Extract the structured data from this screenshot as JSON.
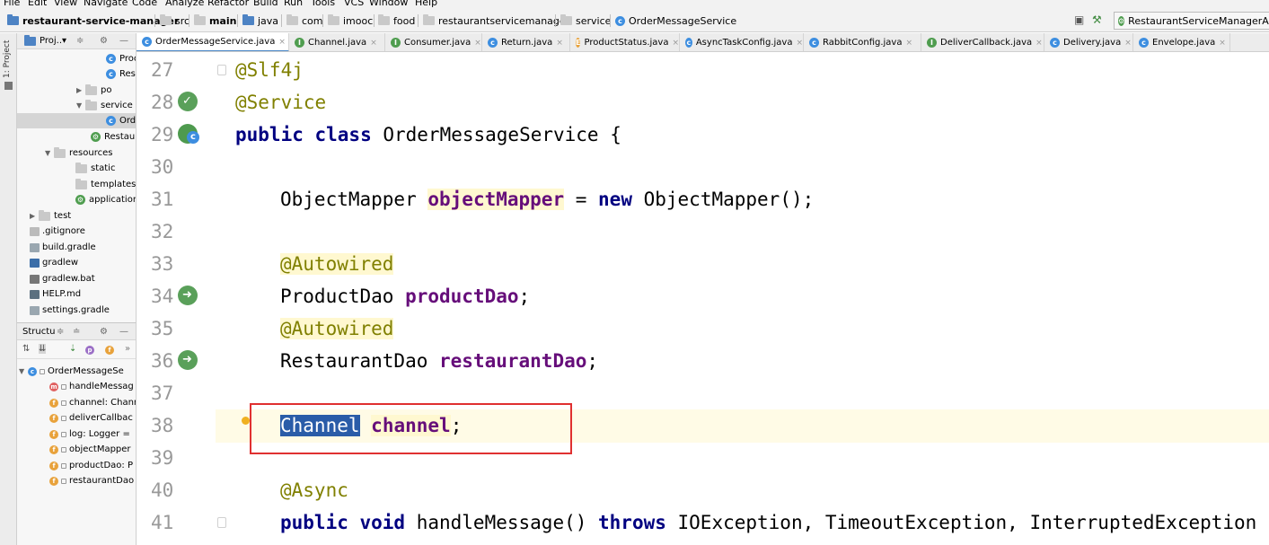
{
  "menu": [
    "File",
    "Edit",
    "View",
    "Navigate",
    "Code",
    "Analyze",
    "Refactor",
    "Build",
    "Run",
    "Tools",
    "VCS",
    "Window",
    "Help"
  ],
  "breadcrumb": [
    "restaurant-service-manager",
    "src",
    "main",
    "java",
    "com",
    "imooc",
    "food",
    "restaurantservicemanager",
    "service",
    "OrderMessageService"
  ],
  "run_config": "RestaurantServiceManagerAppl",
  "sidebar_tab": "1: Project",
  "project_panel": {
    "title": "Proj..▾",
    "tree": [
      {
        "label": "Proc",
        "kind": "class"
      },
      {
        "label": "Rest",
        "kind": "class"
      },
      {
        "label": "po",
        "kind": "package"
      },
      {
        "label": "service",
        "kind": "package"
      },
      {
        "label": "Ord",
        "kind": "class"
      },
      {
        "label": "Restaur",
        "kind": "spring"
      },
      {
        "label": "resources",
        "kind": "folder"
      },
      {
        "label": "static",
        "kind": "folder"
      },
      {
        "label": "templates",
        "kind": "folder"
      },
      {
        "label": "application",
        "kind": "spring"
      },
      {
        "label": "test",
        "kind": "folder"
      },
      {
        "label": ".gitignore",
        "kind": "file"
      },
      {
        "label": "build.gradle",
        "kind": "file"
      },
      {
        "label": "gradlew",
        "kind": "file"
      },
      {
        "label": "gradlew.bat",
        "kind": "file"
      },
      {
        "label": "HELP.md",
        "kind": "file"
      },
      {
        "label": "settings.gradle",
        "kind": "file"
      }
    ]
  },
  "structure_panel": {
    "title": "Structu",
    "root": "OrderMessageSe",
    "items": [
      {
        "label": "handleMessag",
        "kind": "m"
      },
      {
        "label": "channel: Chann",
        "kind": "f"
      },
      {
        "label": "deliverCallbac",
        "kind": "f"
      },
      {
        "label": "log: Logger =",
        "kind": "f"
      },
      {
        "label": "objectMapper",
        "kind": "f"
      },
      {
        "label": "productDao: P",
        "kind": "f"
      },
      {
        "label": "restaurantDao",
        "kind": "f"
      }
    ]
  },
  "tabs": [
    "OrderMessageService.java",
    "Channel.java",
    "Consumer.java",
    "Return.java",
    "ProductStatus.java",
    "AsyncTaskConfig.java",
    "RabbitConfig.java",
    "DeliverCallback.java",
    "Delivery.java",
    "Envelope.java"
  ],
  "code": {
    "line_numbers": [
      "27",
      "28",
      "29",
      "30",
      "31",
      "32",
      "33",
      "34",
      "35",
      "36",
      "37",
      "38",
      "39",
      "40",
      "41"
    ],
    "l27": "@Slf4j",
    "l28": "@Service",
    "l29_kw": "public class",
    "l29_rest": " OrderMessageService {",
    "l31_type": "ObjectMapper ",
    "l31_field": "objectMapper",
    "l31_eq": " = ",
    "l31_new": "new",
    "l31_rest": " ObjectMapper();",
    "l33": "@Autowired",
    "l34_type": "ProductDao ",
    "l34_field": "productDao",
    "l34_end": ";",
    "l35": "@Autowired",
    "l36_type": "RestaurantDao ",
    "l36_field": "restaurantDao",
    "l36_end": ";",
    "l38_type": "Channel",
    "l38_field": "channel",
    "l38_end": ";",
    "l40": "@Async",
    "l41_kw": "public void",
    "l41_mid": " handleMessage() ",
    "l41_throws": "throws",
    "l41_rest": " IOException, TimeoutException, InterruptedException"
  }
}
